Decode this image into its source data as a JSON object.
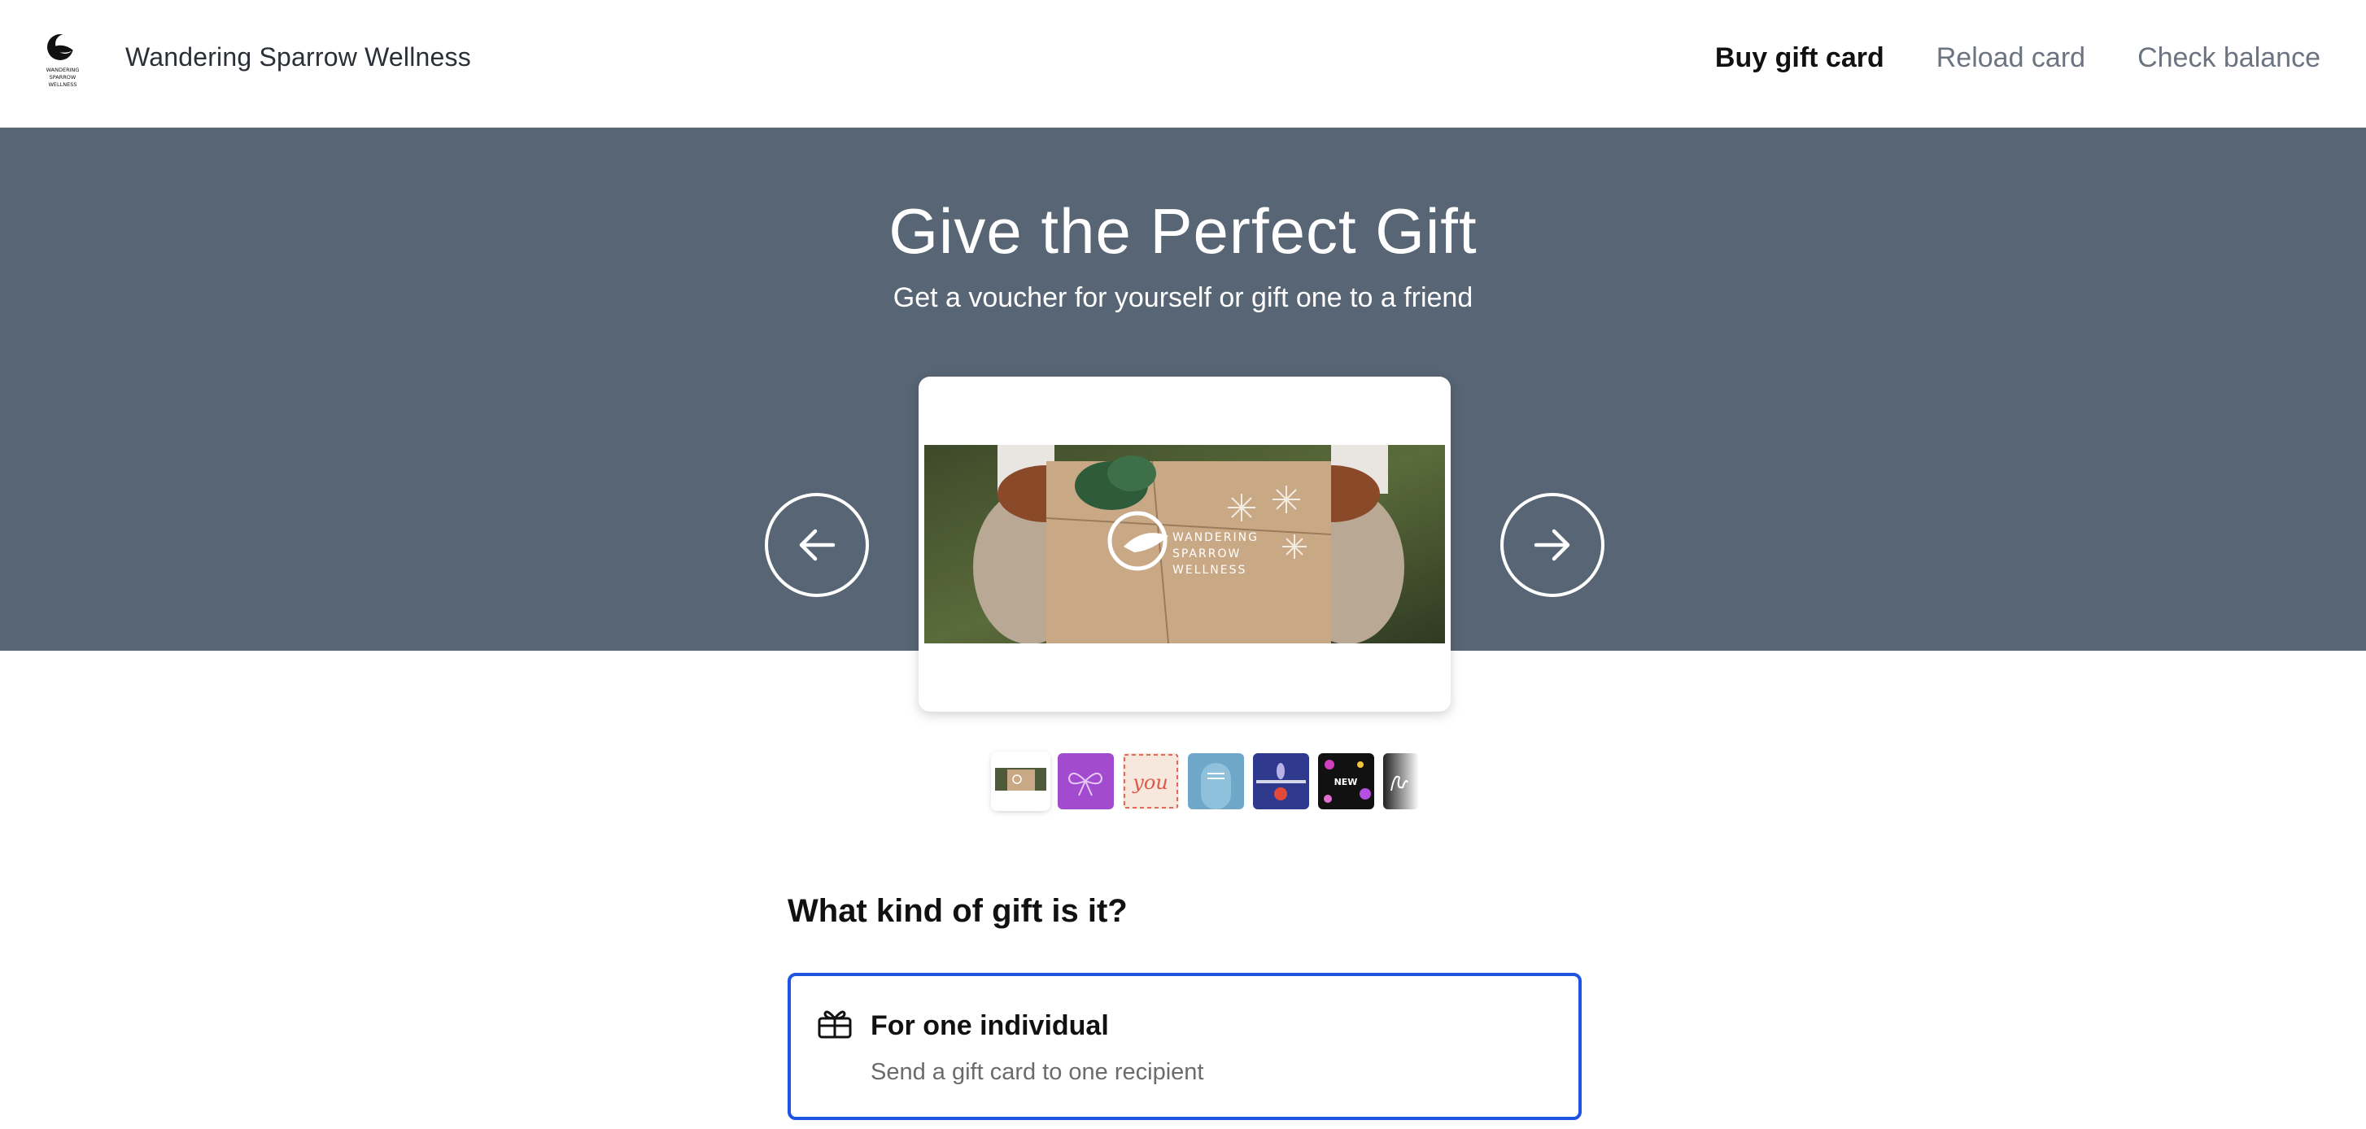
{
  "header": {
    "brand": "Wandering Sparrow Wellness",
    "logo_text": "WANDERING SPARROW WELLNESS",
    "nav": [
      {
        "label": "Buy gift card",
        "active": true
      },
      {
        "label": "Reload card",
        "active": false
      },
      {
        "label": "Check balance",
        "active": false
      }
    ]
  },
  "hero": {
    "title": "Give the Perfect Gift",
    "subtitle": "Get a voucher for yourself or gift one to a friend",
    "background_color": "#586574"
  },
  "carousel": {
    "prev_icon": "arrow-left-icon",
    "next_icon": "arrow-right-icon",
    "card_logo_text": [
      "WANDERING",
      "SPARROW",
      "WELLNESS"
    ],
    "thumbnails": [
      {
        "name": "gift-box-design",
        "selected": true
      },
      {
        "name": "purple-bow-design",
        "selected": false
      },
      {
        "name": "you-envelope-design",
        "selected": false,
        "text": "you"
      },
      {
        "name": "blue-door-design",
        "selected": false
      },
      {
        "name": "navy-celebration-design",
        "selected": false
      },
      {
        "name": "black-new-year-design",
        "selected": false,
        "text": "NEW"
      },
      {
        "name": "thank-you-script-design",
        "selected": false
      }
    ]
  },
  "gift_type": {
    "question": "What kind of gift is it?",
    "options": [
      {
        "title": "For one individual",
        "description": "Send a gift card to one recipient",
        "icon": "gift-icon",
        "selected": true
      }
    ]
  },
  "colors": {
    "accent": "#1f54e0",
    "nav_inactive": "#6b7480"
  }
}
